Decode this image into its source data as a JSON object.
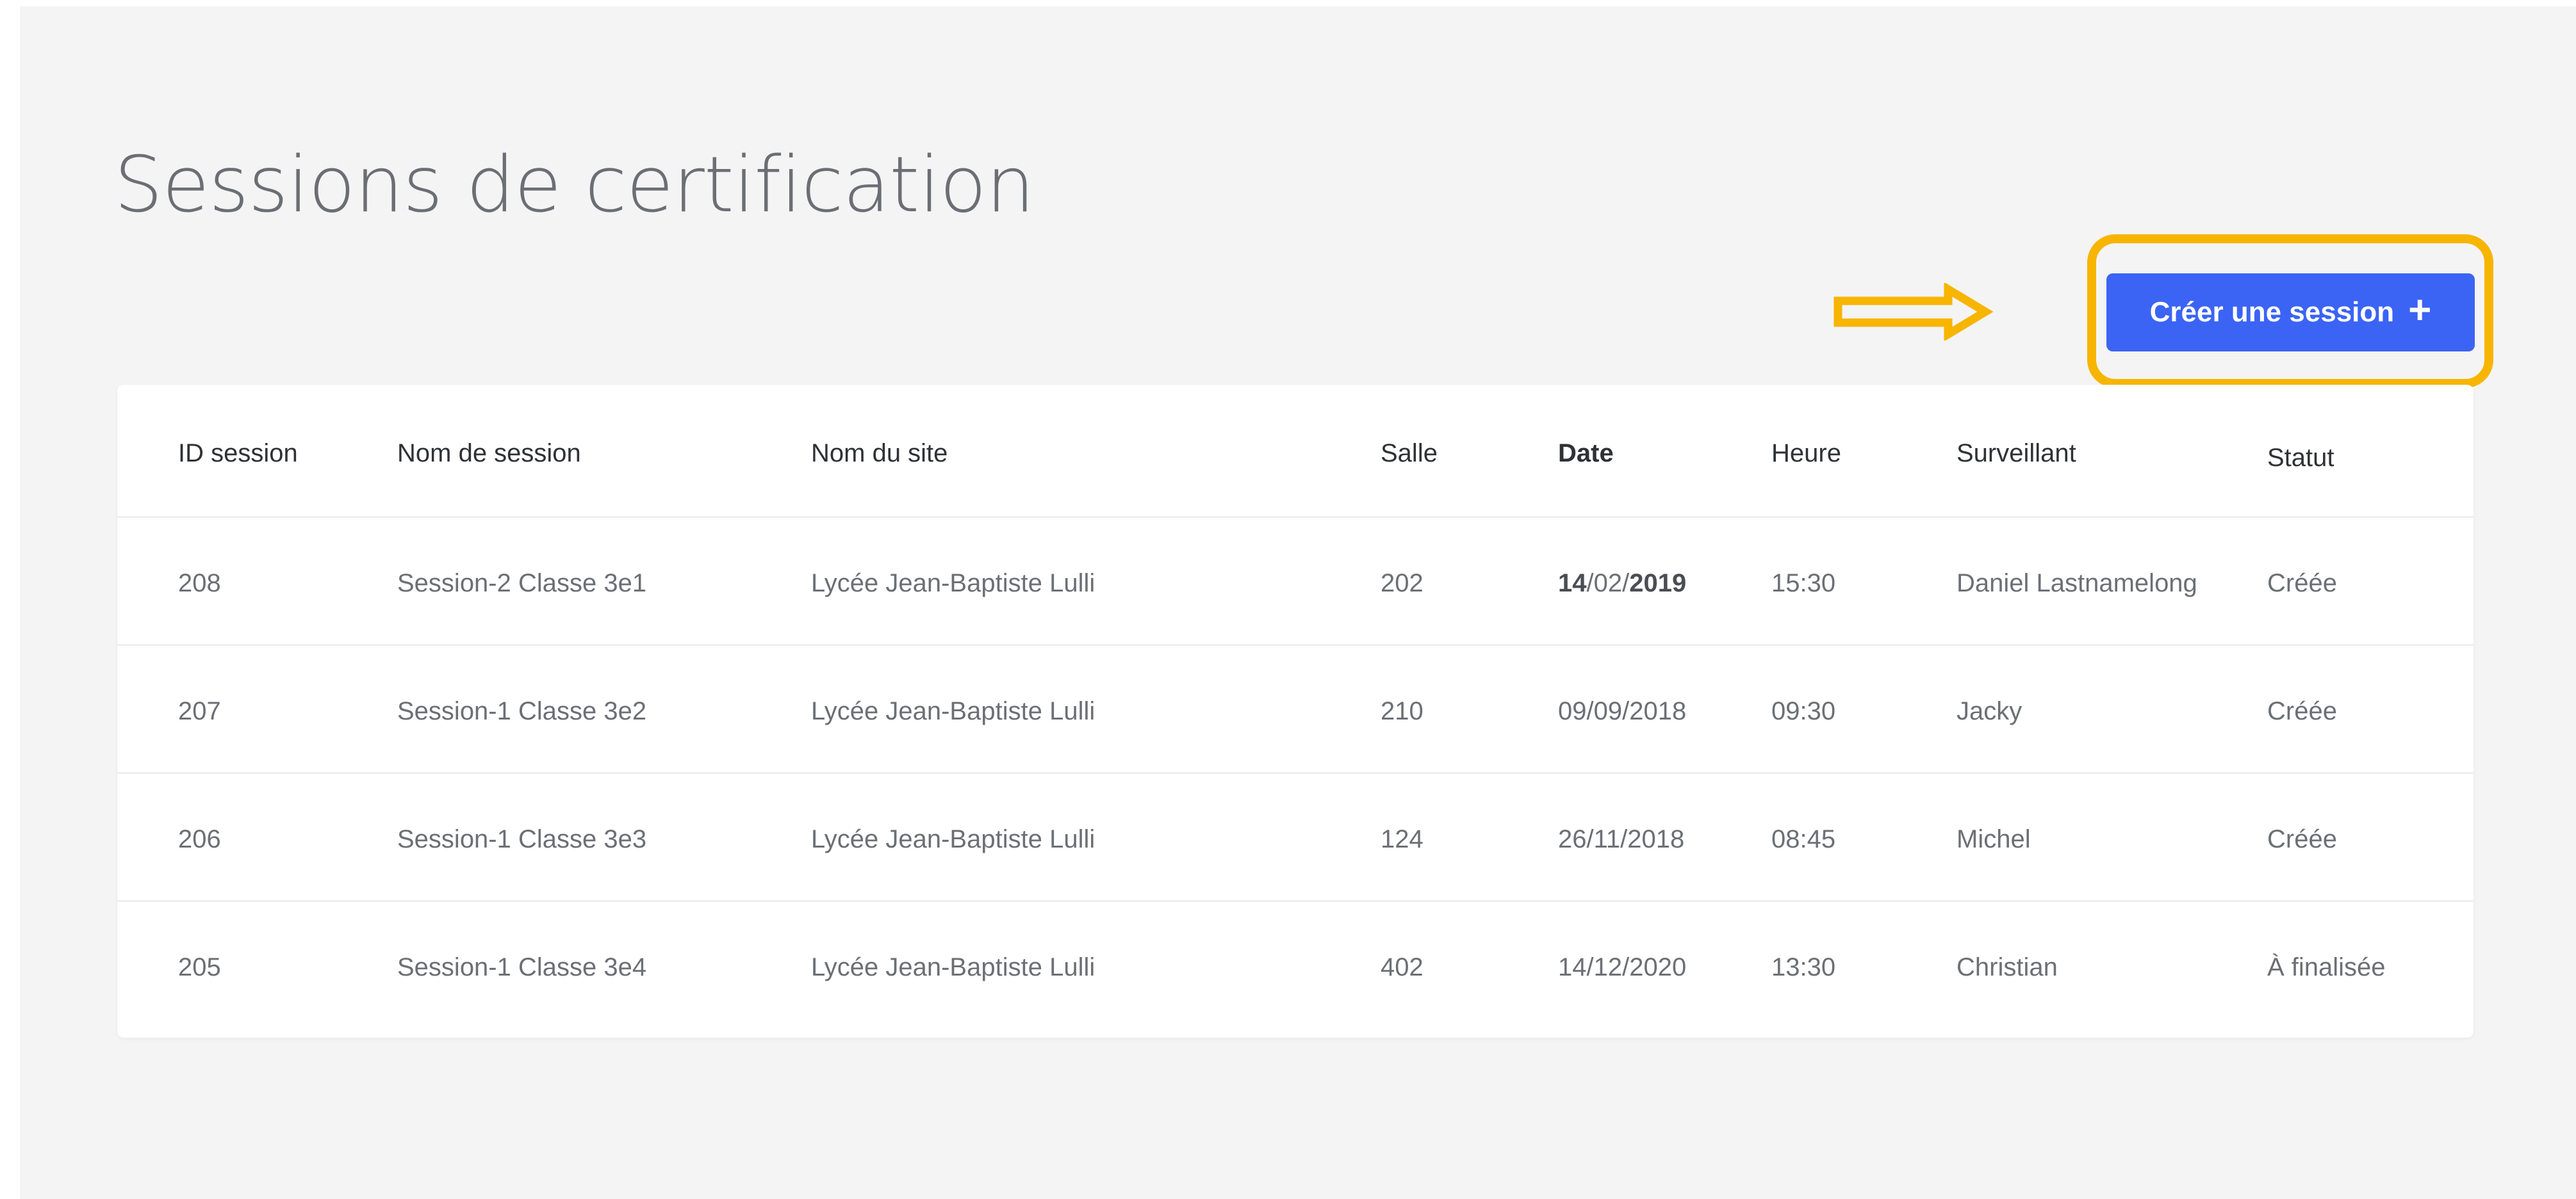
{
  "page": {
    "title": "Sessions de certification"
  },
  "actions": {
    "create_session_label": "Créer une session",
    "create_session_icon": "plus-icon"
  },
  "annotation": {
    "highlight_color": "#f7b500",
    "arrow_icon": "arrow-right-icon"
  },
  "colors": {
    "primary": "#3b64f4",
    "background": "#f4f4f5"
  },
  "table": {
    "columns": [
      "ID session",
      "Nom de session",
      "Nom du site",
      "Salle",
      "Date",
      "Heure",
      "Surveillant",
      "Statut"
    ],
    "rows": [
      {
        "id": "208",
        "name": "Session-2 Classe 3e1",
        "site": "Lycée Jean-Baptiste Lulli",
        "room": "202",
        "date_day": "14",
        "date_mid": "/02/",
        "date_year": "2019",
        "time": "15:30",
        "supervisor": "Daniel Lastnamelong",
        "status": "Créée"
      },
      {
        "id": "207",
        "name": "Session-1 Classe 3e2",
        "site": "Lycée Jean-Baptiste Lulli",
        "room": "210",
        "date": "09/09/2018",
        "time": "09:30",
        "supervisor": "Jacky",
        "status": "Créée"
      },
      {
        "id": "206",
        "name": "Session-1 Classe 3e3",
        "site": "Lycée Jean-Baptiste Lulli",
        "room": "124",
        "date": "26/11/2018",
        "time": "08:45",
        "supervisor": "Michel",
        "status": "Créée"
      },
      {
        "id": "205",
        "name": "Session-1 Classe 3e4",
        "site": "Lycée Jean-Baptiste Lulli",
        "room": "402",
        "date": "14/12/2020",
        "time": "13:30",
        "supervisor": "Christian",
        "status": "À finalisée"
      }
    ]
  }
}
